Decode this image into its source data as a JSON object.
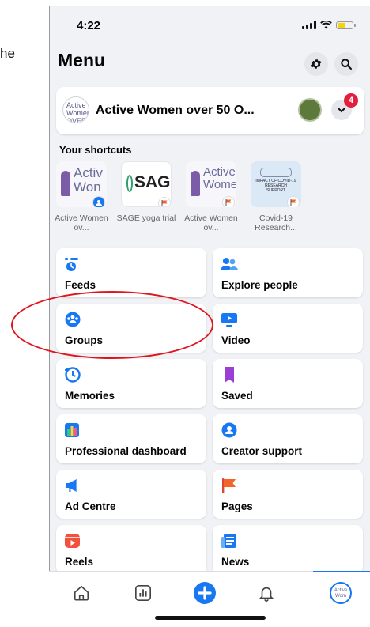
{
  "fragment_text": "he",
  "status": {
    "time": "4:22"
  },
  "header": {
    "title": "Menu"
  },
  "profile": {
    "name": "Active Women over 50 O...",
    "avatar_text": "Active Women OVER",
    "notification_count": "4"
  },
  "shortcuts": {
    "title": "Your shortcuts",
    "items": [
      {
        "label": "Active Women ov...",
        "thumb": "Activ Won"
      },
      {
        "label": "SAGE yoga trial",
        "thumb": "SAG"
      },
      {
        "label": "Active Women ov...",
        "thumb": "Active Wome"
      },
      {
        "label": "Covid-19 Research...",
        "thumb": "IMPACT OF COVID-19 RESEARCH SUPPORT"
      }
    ]
  },
  "menu": {
    "feeds": "Feeds",
    "explore_people": "Explore people",
    "groups": "Groups",
    "video": "Video",
    "memories": "Memories",
    "saved": "Saved",
    "professional_dashboard": "Professional dashboard",
    "creator_support": "Creator support",
    "ad_centre": "Ad Centre",
    "pages": "Pages",
    "reels": "Reels",
    "news": "News"
  },
  "tabbar": {
    "active_avatar_text": "Active Wom"
  },
  "colors": {
    "accent": "#1877f2",
    "annotation": "#e0141d",
    "badge": "#e41e3f"
  }
}
